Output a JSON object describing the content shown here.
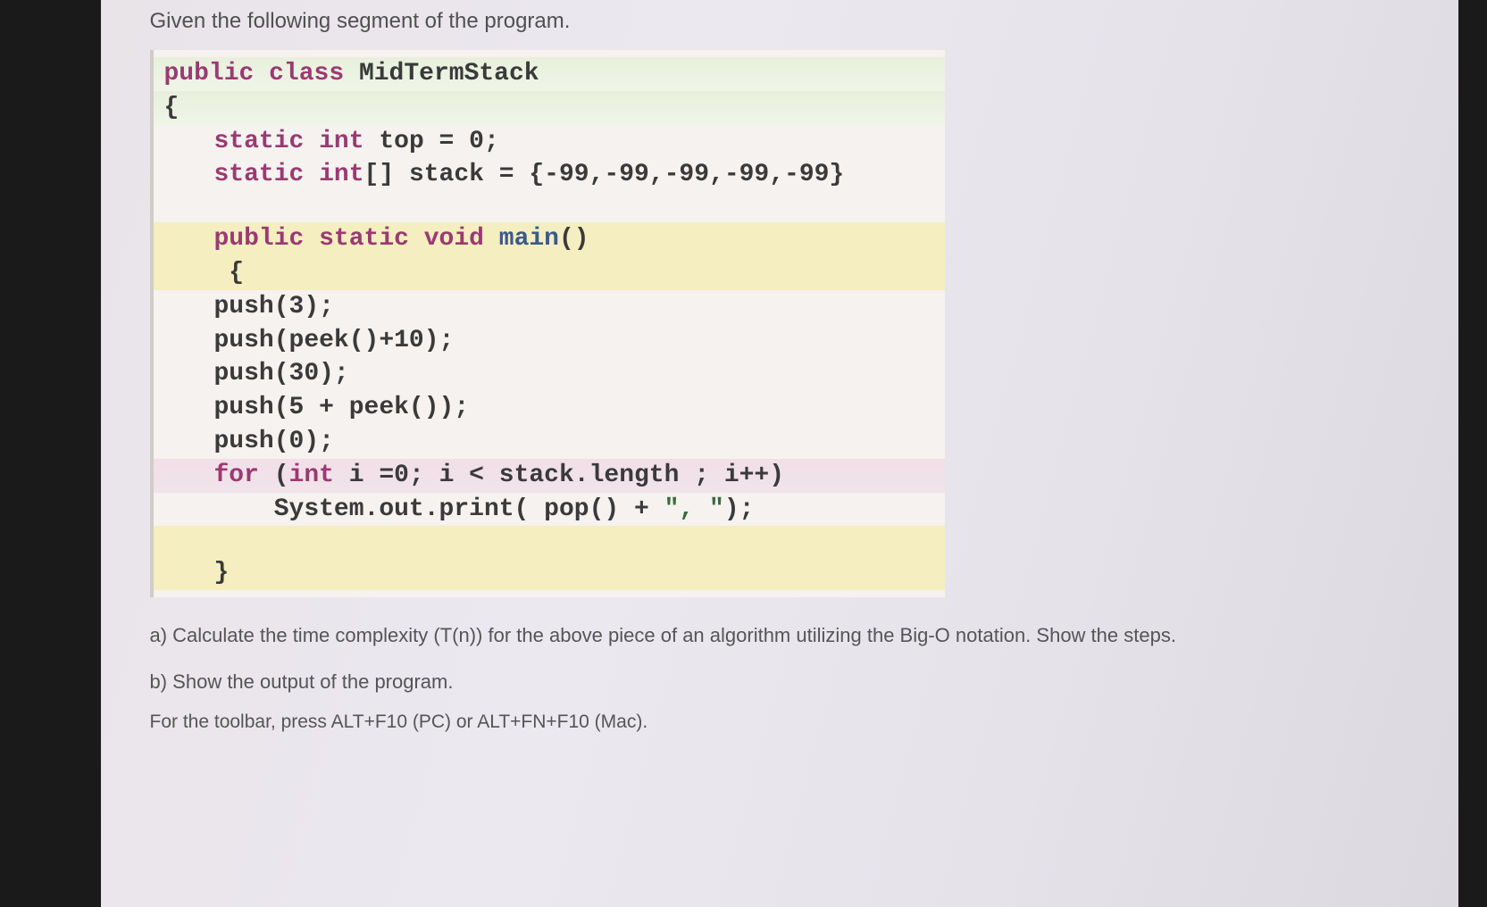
{
  "intro": "Given the following segment of the program.",
  "code": {
    "l1_public": "public ",
    "l1_class": "class ",
    "l1_name": "MidTermStack",
    "l2_brace": "{",
    "l3_static": "static ",
    "l3_int": "int ",
    "l3_rest": "top = 0;",
    "l4_static": "static ",
    "l4_int": "int",
    "l4_rest": "[] stack = {-99,-99,-99,-99,-99}",
    "l5_public": "public ",
    "l5_static": "static ",
    "l5_void": "void ",
    "l5_main": "main",
    "l5_paren": "()",
    "l6_brace": " {",
    "l7": "push(3);",
    "l8": "push(peek()+10);",
    "l9": "push(30);",
    "l10": "push(5 + peek());",
    "l11": "push(0);",
    "l12_for": "for ",
    "l12_open": "(",
    "l12_int": "int ",
    "l12_rest": "i =0; i < stack.length ; i++)",
    "l13_a": "    System.out.print( pop() + ",
    "l13_str": "\", \"",
    "l13_b": ");",
    "l14_brace": "}"
  },
  "question_a": "a) Calculate the time complexity (T(n)) for the above piece of an algorithm utilizing the Big-O notation. Show the steps.",
  "question_b": "b) Show the output of the program.",
  "toolbar_hint": "For the toolbar, press ALT+F10 (PC) or ALT+FN+F10 (Mac)."
}
